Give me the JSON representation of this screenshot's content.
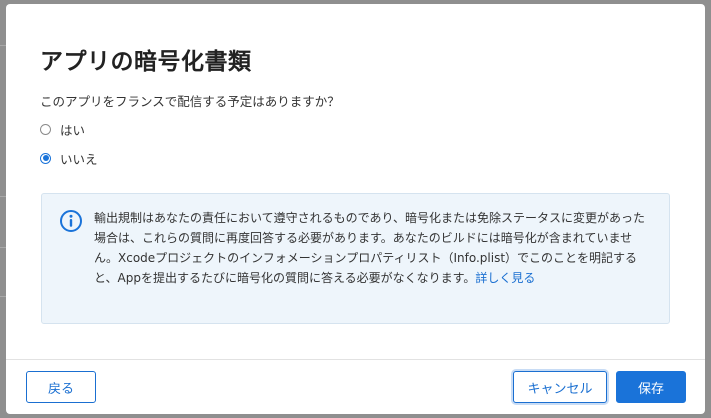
{
  "dialog": {
    "title": "アプリの暗号化書類",
    "question": "このアプリをフランスで配信する予定はありますか？",
    "options": [
      {
        "label": "はい",
        "checked": false
      },
      {
        "label": "いいえ",
        "checked": true
      }
    ],
    "info": {
      "icon": "info-icon",
      "text": "輸出規制はあなたの責任において遵守されるものであり、暗号化または免除ステータスに変更があった場合は、これらの質問に再度回答する必要があります。あなたのビルドには暗号化が含まれていません。Xcodeプロジェクトのインフォメーションプロパティリスト（Info.plist）でこのことを明記すると、Appを提出するたびに暗号化の質問に答える必要がなくなります。",
      "link": "詳しく見る"
    },
    "buttons": {
      "back": "戻る",
      "cancel": "キャンセル",
      "save": "保存"
    }
  },
  "colors": {
    "accent": "#1a73d9",
    "info_bg": "#eef5fb",
    "overlay": "#8f8f8f"
  }
}
